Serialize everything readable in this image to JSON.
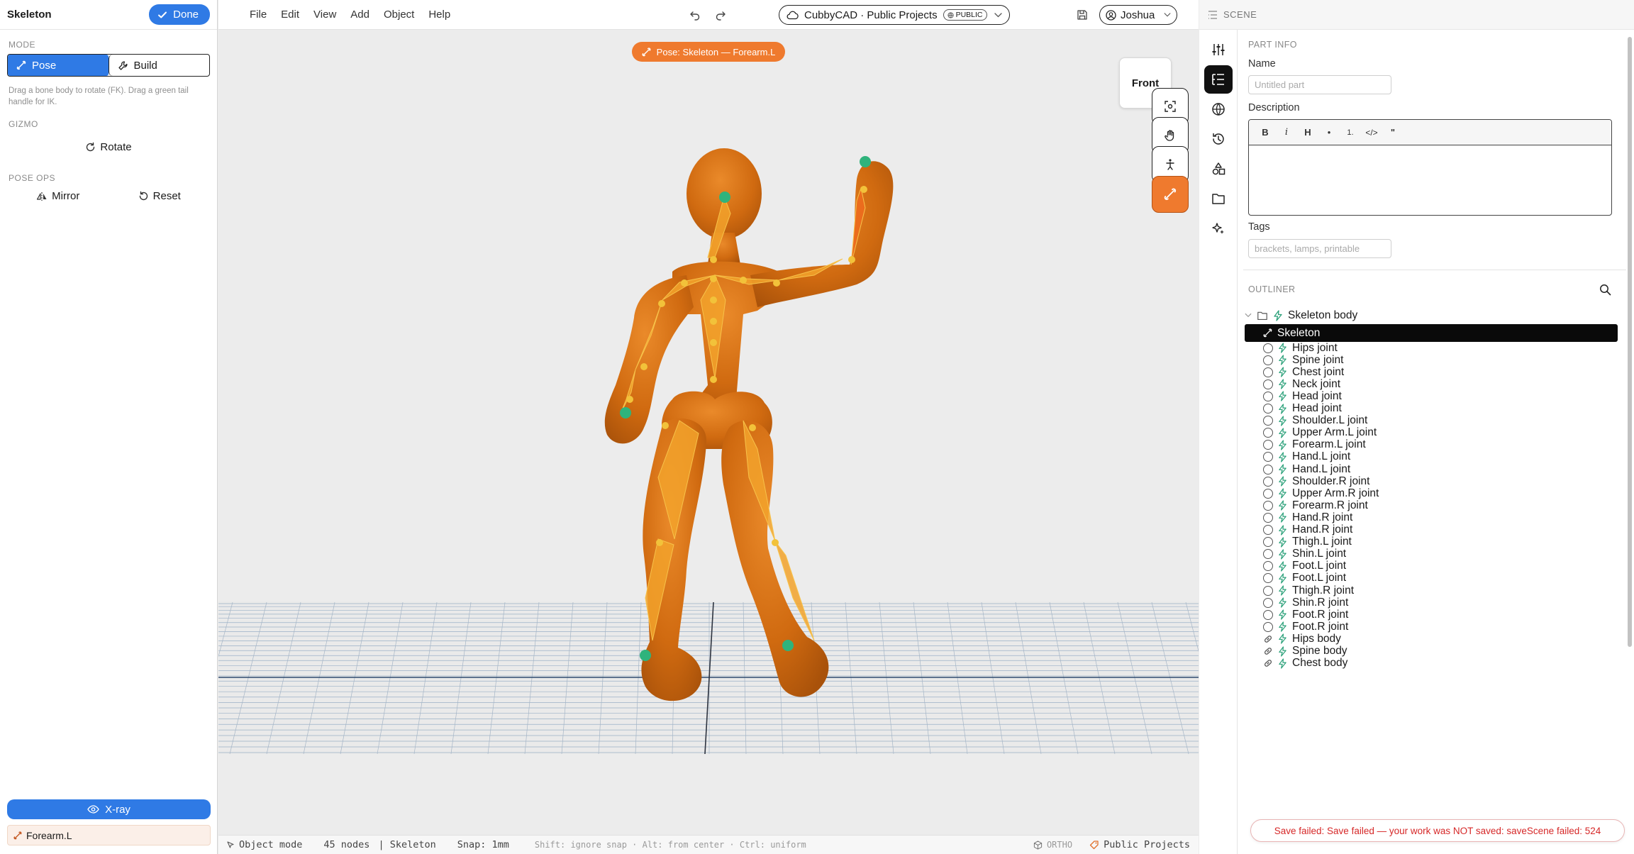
{
  "left_panel": {
    "title": "Skeleton",
    "done_label": "Done",
    "mode_label": "MODE",
    "pose_label": "Pose",
    "build_label": "Build",
    "hint": "Drag a bone body to rotate (FK). Drag a green tail handle for IK.",
    "gizmo_label": "GIZMO",
    "rotate_label": "Rotate",
    "pose_ops_label": "POSE OPS",
    "mirror_label": "Mirror",
    "reset_label": "Reset",
    "xray_label": "X-ray",
    "selected_bone": "Forearm.L"
  },
  "menu": [
    "File",
    "Edit",
    "View",
    "Add",
    "Object",
    "Help"
  ],
  "project": {
    "name": "CubbyCAD · Public Projects",
    "badge": "PUBLIC"
  },
  "user": {
    "name": "Joshua"
  },
  "viewport": {
    "pose_chip": "Pose: Skeleton — Forearm.L",
    "view_label": "Front",
    "figure_color": "#d6700f",
    "handle_color": "#2fb37c"
  },
  "status": {
    "mode": "Object mode",
    "nodes": "45 nodes",
    "object": "| Skeleton",
    "snap": "Snap: 1mm",
    "hint": "Shift: ignore snap · Alt: from center · Ctrl: uniform",
    "projection": "ORTHO",
    "project": "Public Projects"
  },
  "scene_header": "SCENE",
  "part_info": {
    "section": "PART INFO",
    "name_label": "Name",
    "name_placeholder": "Untitled part",
    "description_label": "Description",
    "toolbar": [
      "B",
      "i",
      "H",
      "•",
      "1.",
      "</>",
      "\""
    ],
    "tags_label": "Tags",
    "tags_placeholder": "brackets, lamps, printable"
  },
  "outliner": {
    "section": "OUTLINER",
    "root": "Skeleton body",
    "selected": "Skeleton",
    "joints": [
      "Hips joint",
      "Spine joint",
      "Chest joint",
      "Neck joint",
      "Head joint",
      "Head joint",
      "Shoulder.L joint",
      "Upper Arm.L joint",
      "Forearm.L joint",
      "Hand.L joint",
      "Hand.L joint",
      "Shoulder.R joint",
      "Upper Arm.R joint",
      "Forearm.R joint",
      "Hand.R joint",
      "Hand.R joint",
      "Thigh.L joint",
      "Shin.L joint",
      "Foot.L joint",
      "Foot.L joint",
      "Thigh.R joint",
      "Shin.R joint",
      "Foot.R joint",
      "Foot.R joint"
    ],
    "bodies": [
      "Hips body",
      "Spine body",
      "Chest body"
    ]
  },
  "toast": "Save failed: Save failed — your work was NOT saved: saveScene failed: 524"
}
